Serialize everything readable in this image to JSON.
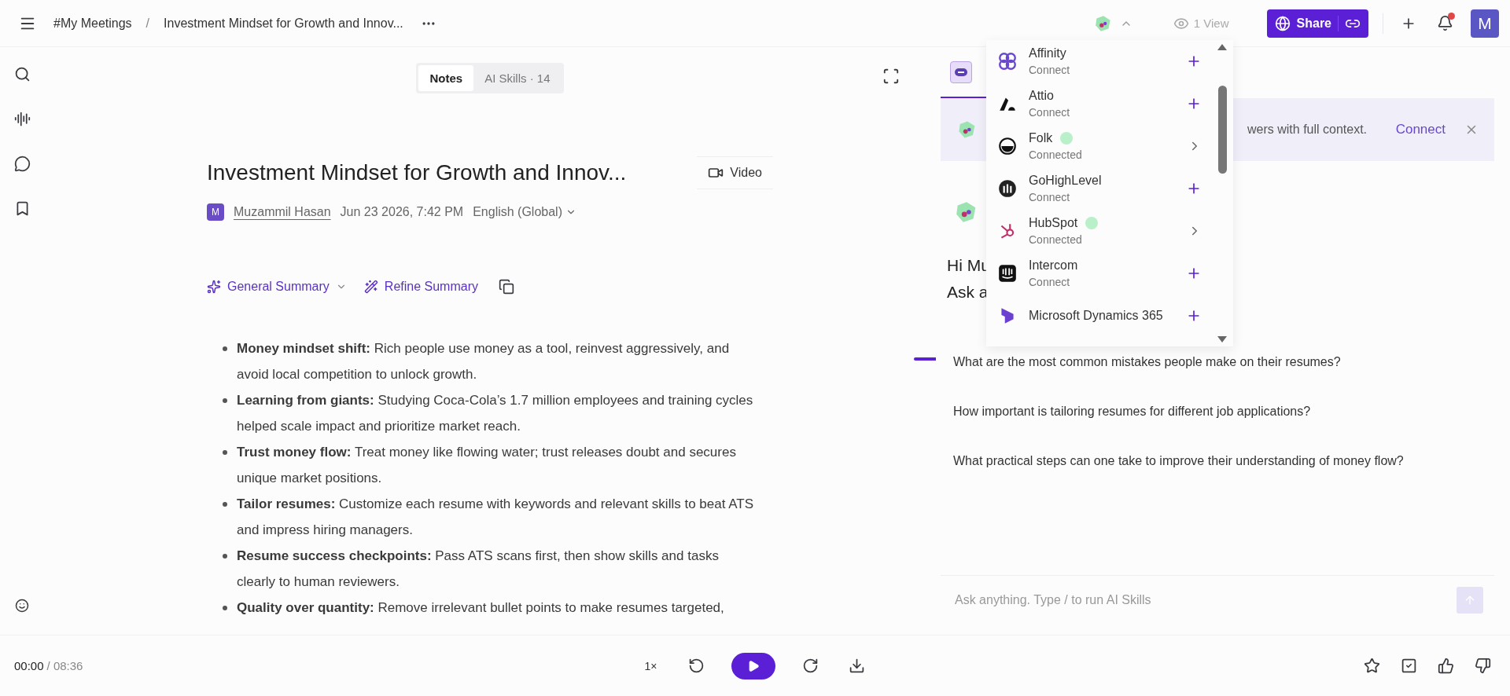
{
  "top_bar": {
    "breadcrumb": [
      "#My Meetings",
      "Investment Mindset for Growth and Innov..."
    ],
    "breadcrumb_separator": "/",
    "integrations_open": true,
    "views": "1 View",
    "share_label": "Share",
    "avatar": "M",
    "notification_unread": true
  },
  "notes_tabs": [
    {
      "label": "Notes",
      "selected": true
    },
    {
      "label": "AI Skills · 14",
      "selected": false
    }
  ],
  "meeting": {
    "title": "Investment Mindset for Growth and Innov...",
    "video_label": "Video",
    "author_initial": "M",
    "author": "Muzammil Hasan",
    "date": "Jun 23 2026, 7:42 PM",
    "language": "English (Global)"
  },
  "summary_toolbar": {
    "template": "General Summary",
    "refine": "Refine Summary"
  },
  "bullets": [
    "**Money mindset shift:** Rich people use money as a tool, reinvest aggressively, and avoid local competition to unlock growth.",
    "**Learning from giants:** Studying Coca-Cola’s 1.7 million employees and training cycles helped scale impact and prioritize market reach.",
    "**Trust money flow:** Treat money like flowing water; trust releases doubt and secures unique market positions.",
    "**Tailor resumes:** Customize each resume with keywords and relevant skills to beat ATS and impress hiring managers.",
    "**Resume success checkpoints:** Pass ATS scans first, then show skills and tasks clearly to human reviewers.",
    "**Quality over quantity:** Remove irrelevant bullet points to make resumes targeted,"
  ],
  "integrations": [
    {
      "name": "Affinity",
      "status": "Connect",
      "connected": false,
      "kind": "affinity"
    },
    {
      "name": "Attio",
      "status": "Connect",
      "connected": false,
      "kind": "attio"
    },
    {
      "name": "Folk",
      "status": "Connected",
      "connected": true,
      "kind": "folk"
    },
    {
      "name": "GoHighLevel",
      "status": "Connect",
      "connected": false,
      "kind": "gohighlevel"
    },
    {
      "name": "HubSpot",
      "status": "Connected",
      "connected": true,
      "kind": "hubspot"
    },
    {
      "name": "Intercom",
      "status": "Connect",
      "connected": false,
      "kind": "intercom"
    },
    {
      "name": "Microsoft Dynamics 365",
      "connected": false,
      "kind": "dynamics"
    }
  ],
  "banner": {
    "text": "wers with full context.",
    "link": "Connect"
  },
  "greeting": [
    "Hi Mu",
    "Ask a"
  ],
  "suggestions": [
    "What are the most common mistakes people make on their resumes?",
    "How important is tailoring resumes for different job applications?",
    "What practical steps can one take to improve their understanding of money flow?"
  ],
  "chat_input": {
    "placeholder": "Ask anything. Type / to run AI Skills"
  },
  "player": {
    "current": "00:00",
    "total": "/ 08:36",
    "speed": "1×"
  }
}
